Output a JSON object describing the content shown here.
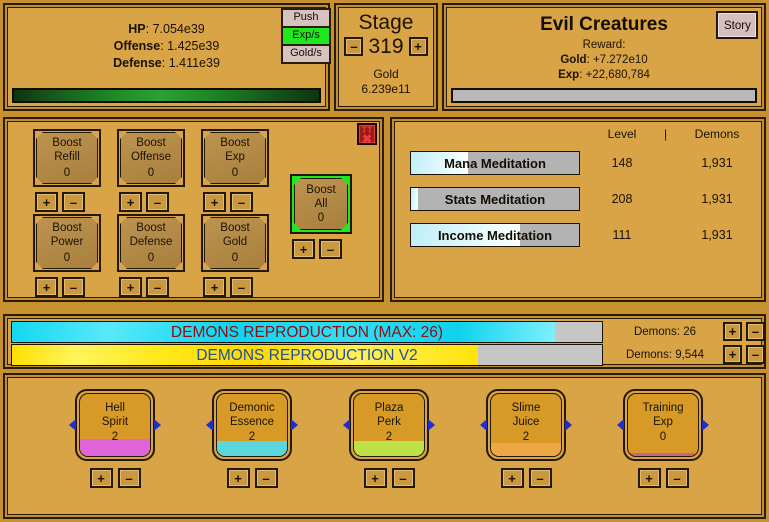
{
  "stats": {
    "hp_label": "HP",
    "hp_value": "7.054e39",
    "offense_label": "Offense",
    "offense_value": "1.425e39",
    "defense_label": "Defense",
    "defense_value": "1.411e39",
    "hp_percent": 100
  },
  "rate_toggles": [
    {
      "label": "Push",
      "active": false
    },
    {
      "label": "Exp/s",
      "active": true
    },
    {
      "label": "Gold/s",
      "active": false
    }
  ],
  "stage": {
    "title": "Stage",
    "number": "319",
    "minus": "–",
    "plus": "+",
    "gold_label": "Gold",
    "gold_value": "6.239e11"
  },
  "enemy": {
    "name": "Evil Creatures",
    "reward_label": "Reward:",
    "gold_label": "Gold",
    "gold_value": "+7.272e10",
    "exp_label": "Exp",
    "exp_value": "+22,680,784",
    "progress_percent": 0,
    "story_label": "Story"
  },
  "boosts": {
    "close_top": "TT",
    "close_x": "✖",
    "items": [
      {
        "line1": "Boost",
        "line2": "Refill",
        "value": "0",
        "plus": "+",
        "minus": "–"
      },
      {
        "line1": "Boost",
        "line2": "Offense",
        "value": "0",
        "plus": "+",
        "minus": "–"
      },
      {
        "line1": "Boost",
        "line2": "Exp",
        "value": "0",
        "plus": "+",
        "minus": "–"
      },
      {
        "line1": "Boost",
        "line2": "Power",
        "value": "0",
        "plus": "+",
        "minus": "–"
      },
      {
        "line1": "Boost",
        "line2": "Defense",
        "value": "0",
        "plus": "+",
        "minus": "–"
      },
      {
        "line1": "Boost",
        "line2": "Gold",
        "value": "0",
        "plus": "+",
        "minus": "–"
      }
    ],
    "boost_all": {
      "line1": "Boost",
      "line2": "All",
      "value": "0",
      "plus": "+",
      "minus": "–"
    }
  },
  "meditation": {
    "header": {
      "level": "Level",
      "separator": "|",
      "demons": "Demons"
    },
    "rows": [
      {
        "name": "Mana Meditation",
        "level": "148",
        "demons": "1,931",
        "progress_percent": 34
      },
      {
        "name": "Stats Meditation",
        "level": "208",
        "demons": "1,931",
        "progress_percent": 4
      },
      {
        "name": "Income Meditation",
        "level": "111",
        "demons": "1,931",
        "progress_percent": 65
      }
    ]
  },
  "reproduction": {
    "rows": [
      {
        "label": "DEMONS REPRODUCTION (MAX: 26)",
        "progress_percent": 92,
        "count_label": "Demons: 26",
        "plus": "+",
        "minus": "–",
        "fill_color": "#12d8f2",
        "text_color": "#8c1010"
      },
      {
        "label": "DEMONS REPRODUCTION V2",
        "progress_percent": 79,
        "count_label": "Demons: 9,544",
        "plus": "+",
        "minus": "–",
        "fill_color": "#ffe000",
        "text_color": "#1e4fa0"
      }
    ]
  },
  "cards": [
    {
      "line1": "Hell",
      "line2": "Spirit",
      "value": "2",
      "plus": "+",
      "minus": "–",
      "liquid_color": "#e060e8",
      "liquid_height": 17
    },
    {
      "line1": "Demonic",
      "line2": "Essence",
      "value": "2",
      "plus": "+",
      "minus": "–",
      "liquid_color": "#4fdbec",
      "liquid_height": 15
    },
    {
      "line1": "Plaza",
      "line2": "Perk",
      "value": "2",
      "plus": "+",
      "minus": "–",
      "liquid_color": "#b9e84a",
      "liquid_height": 15
    },
    {
      "line1": "Slime",
      "line2": "Juice",
      "value": "2",
      "plus": "+",
      "minus": "–",
      "liquid_color": "#f0a848",
      "liquid_height": 13
    },
    {
      "line1": "Training",
      "line2": "Exp",
      "value": "0",
      "plus": "+",
      "minus": "–",
      "liquid_color": "#c86090",
      "liquid_height": 3
    }
  ]
}
